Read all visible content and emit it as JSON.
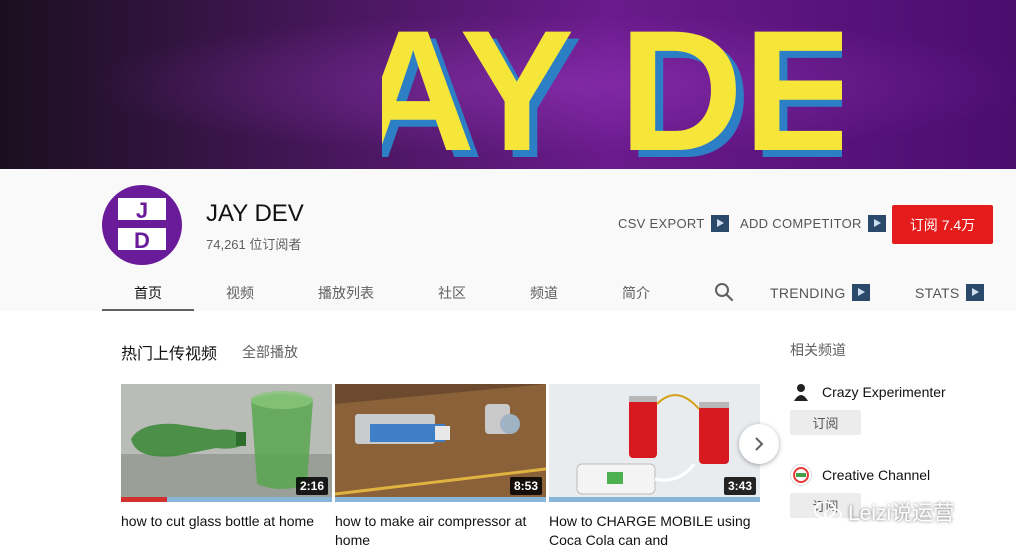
{
  "banner": {
    "text": "JAY DEV"
  },
  "channel": {
    "avatar_initials_top": "J",
    "avatar_initials_bottom": "D",
    "name": "JAY DEV",
    "subscribers": "74,261 位订阅者"
  },
  "header_actions": {
    "csv_export": "CSV EXPORT",
    "add_competitor": "ADD COMPETITOR",
    "subscribe": "订阅 7.4万"
  },
  "tabs": [
    {
      "label": "首页",
      "active": true
    },
    {
      "label": "视频"
    },
    {
      "label": "播放列表"
    },
    {
      "label": "社区"
    },
    {
      "label": "频道"
    },
    {
      "label": "简介"
    }
  ],
  "tab_extras": {
    "trending": "TRENDING",
    "stats": "STATS",
    "search_icon": "search-icon"
  },
  "section": {
    "title": "热门上传视频",
    "play_all": "全部播放"
  },
  "videos": [
    {
      "title": "how to cut glass bottle at home",
      "duration": "2:16",
      "progress": 0.22
    },
    {
      "title": "how to make air compressor at home",
      "duration": "8:53",
      "progress": 0
    },
    {
      "title": "How to CHARGE MOBILE using Coca Cola can and",
      "duration": "3:43",
      "progress": 0
    }
  ],
  "sidebar": {
    "title": "相关频道",
    "channels": [
      {
        "name": "Crazy Experimenter",
        "subscribe": "订阅"
      },
      {
        "name": "Creative Channel",
        "subscribe": "订阅"
      }
    ]
  },
  "watermark": {
    "text": "Leizi说运营"
  },
  "colors": {
    "subscribe": "#e61c1c",
    "avatar": "#6a1b9a",
    "banner_text": "#f7e63a"
  }
}
